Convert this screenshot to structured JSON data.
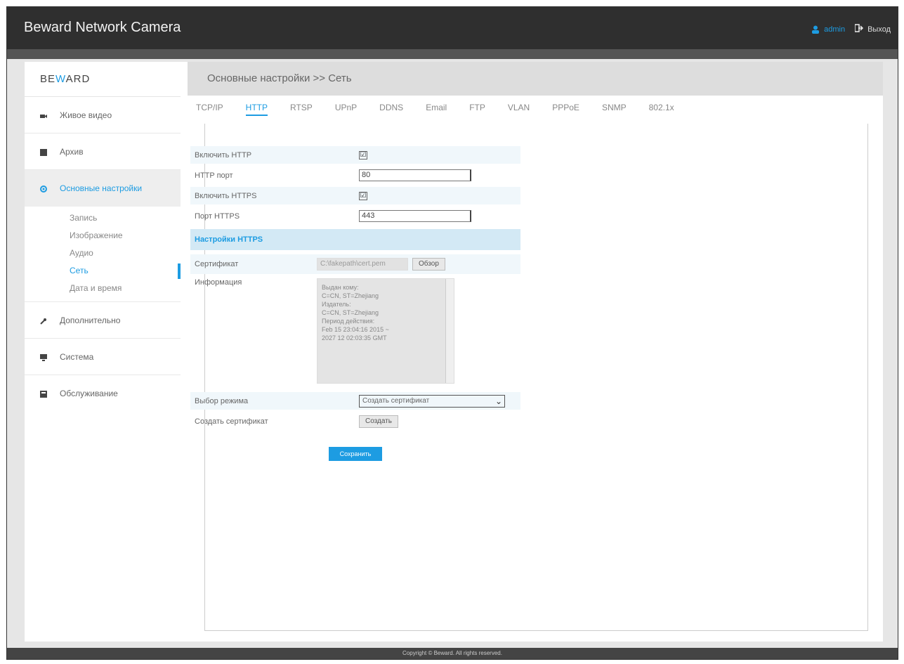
{
  "header": {
    "title": "Beward Network Camera",
    "user": "admin",
    "logout": "Выход"
  },
  "sidebar": {
    "logo_left": "BE",
    "logo_w": "W",
    "logo_right": "ARD",
    "items": [
      {
        "label": "Живое видео"
      },
      {
        "label": "Архив"
      },
      {
        "label": "Основные настройки"
      },
      {
        "label": "Дополнительно"
      },
      {
        "label": "Система"
      },
      {
        "label": "Обслуживание"
      }
    ],
    "subitems": [
      {
        "label": "Запись"
      },
      {
        "label": "Изображение"
      },
      {
        "label": "Аудио"
      },
      {
        "label": "Сеть"
      },
      {
        "label": "Дата и время"
      }
    ]
  },
  "main": {
    "breadcrumb": "Основные настройки >> Сеть",
    "tabs": [
      "TCP/IP",
      "HTTP",
      "RTSP",
      "UPnP",
      "DDNS",
      "Email",
      "FTP",
      "VLAN",
      "PPPoE",
      "SNMP",
      "802.1x"
    ]
  },
  "form": {
    "enable_http_label": "Включить HTTP",
    "enable_http_checked": "☑",
    "http_port_label": "HTTP порт",
    "http_port_value": "80",
    "enable_https_label": "Включить HTTPS",
    "enable_https_checked": "☑",
    "https_port_label": "Порт HTTPS",
    "https_port_value": "443",
    "section_title": "Настройки HTTPS",
    "cert_label": "Сертификат",
    "cert_value": "C:\\fakepath\\cert.pem",
    "browse_label": "Обзор",
    "info_label": "Информация",
    "info_text": "Выдан кому:\nC=CN, ST=Zhejiang\nИздатель:\nC=CN, ST=Zhejiang\nПериод действия:\nFeb 15 23:04:16 2015 ~\n2027 12 02:03:35 GMT",
    "mode_label": "Выбор режима",
    "mode_value": "Создать сертификат",
    "create_label": "Создать сертификат",
    "create_btn": "Создать",
    "save_btn": "Сохранить"
  },
  "footer": "Copyright © Beward. All rights reserved."
}
